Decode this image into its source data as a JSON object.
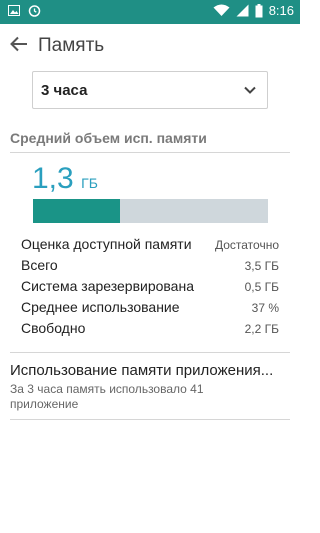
{
  "status_bar": {
    "time": "8:16",
    "icons": [
      "image-icon",
      "alarm-icon",
      "wifi-icon",
      "signal-icon",
      "battery-icon"
    ]
  },
  "header": {
    "back_icon": "arrow-left-icon",
    "title": "Память"
  },
  "range_selector": {
    "value": "3 часа",
    "icon": "chevron-down-icon"
  },
  "average_section": {
    "title": "Средний объем исп. памяти",
    "value": "1,3",
    "unit": "ГБ",
    "usage_fraction": 0.37
  },
  "stats": [
    {
      "label": "Оценка доступной памяти",
      "value": "Достаточно"
    },
    {
      "label": "Всего",
      "value": "3,5 ГБ"
    },
    {
      "label": "Система зарезервирована",
      "value": "0,5 ГБ"
    },
    {
      "label": "Среднее использование",
      "value": "37 %"
    },
    {
      "label": "Свободно",
      "value": "2,2 ГБ"
    }
  ],
  "app_usage": {
    "title": "Использование памяти приложения...",
    "description": "За 3 часа память использовало 41 приложение"
  },
  "colors": {
    "status_bar": "#1f8f85",
    "accent_blue": "#2a9fbe",
    "bar_fill": "#1a9487",
    "bar_track": "#cfd7dc"
  }
}
